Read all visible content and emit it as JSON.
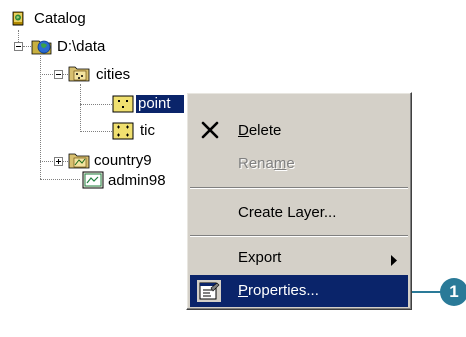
{
  "tree": {
    "root": "Catalog",
    "drive": "D:\\data",
    "cities": "cities",
    "point": "point",
    "tic": "tic",
    "country": "country9",
    "admin": "admin98"
  },
  "menu": {
    "delete_pre": "",
    "delete_u": "D",
    "delete_post": "elete",
    "rename_pre": "Rena",
    "rename_u": "m",
    "rename_post": "e",
    "create_layer": "Create Layer...",
    "export": "Export",
    "properties_pre": "",
    "properties_u": "P",
    "properties_post": "roperties..."
  },
  "callout": {
    "number": "1"
  },
  "colors": {
    "selection": "#0a246a",
    "menu_bg": "#d4d0c8",
    "callout": "#2a7a98"
  }
}
